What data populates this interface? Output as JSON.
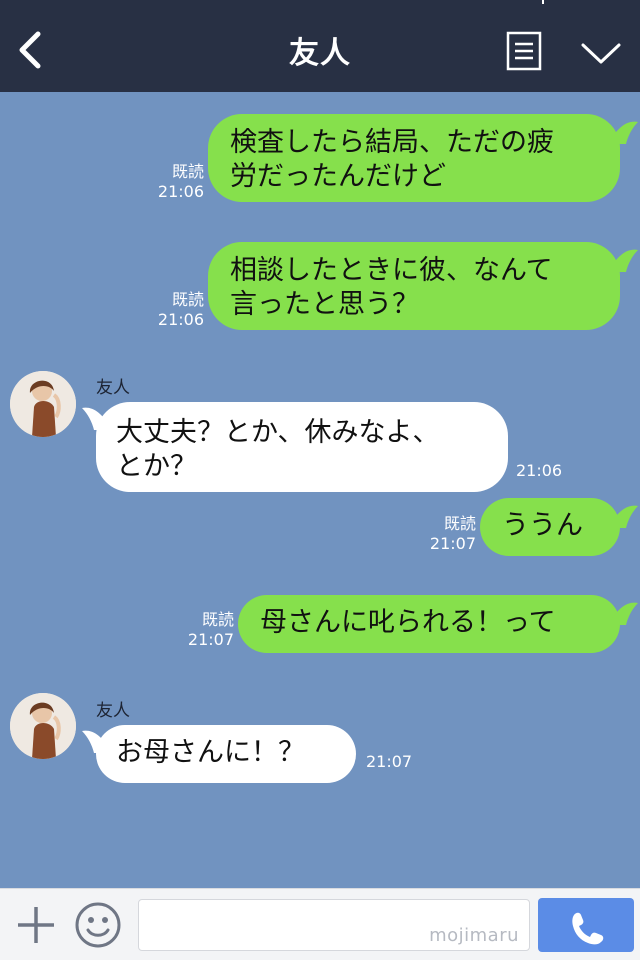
{
  "header": {
    "title": "友人"
  },
  "messages": [
    {
      "direction": "out",
      "lines": [
        "検査したら結局、ただの疲",
        "労だったんだけど"
      ],
      "read": "既読",
      "time": "21:06"
    },
    {
      "direction": "out",
      "lines": [
        "相談したときに彼、なんて",
        "言ったと思う？"
      ],
      "read": "既読",
      "time": "21:06"
    },
    {
      "direction": "in",
      "sender": "友人",
      "lines": [
        "大丈夫？とか、休みなよ、",
        "とか？"
      ],
      "time": "21:06"
    },
    {
      "direction": "out",
      "lines": [
        "ううん"
      ],
      "read": "既読",
      "time": "21:07"
    },
    {
      "direction": "out",
      "lines": [
        "母さんに叱られる！って"
      ],
      "read": "既読",
      "time": "21:07"
    },
    {
      "direction": "in",
      "sender": "友人",
      "lines": [
        "お母さんに！？"
      ],
      "time": "21:07"
    }
  ],
  "input": {
    "value": "",
    "watermark": "mojimaru"
  },
  "colors": {
    "header_bg": "#283044",
    "chat_bg": "#7193c0",
    "outgoing_bubble": "#86e04c",
    "incoming_bubble": "#ffffff",
    "call_button": "#5b8ce6"
  },
  "icons": [
    "back-arrow-icon",
    "menu-list-icon",
    "chevron-down-icon",
    "plus-icon",
    "smiley-icon",
    "phone-icon"
  ]
}
